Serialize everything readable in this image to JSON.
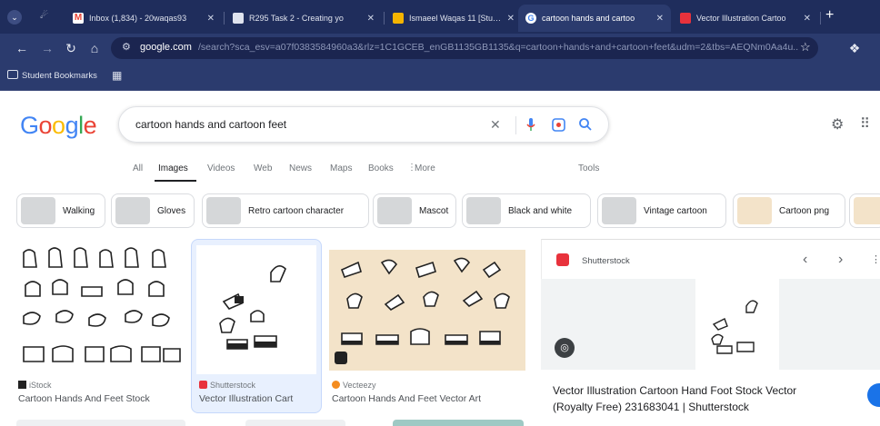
{
  "tabs": [
    {
      "label": "Inbox (1,834) - 20waqas93",
      "favicon": "gmail",
      "active": false
    },
    {
      "label": "R295 Task 2 - Creating yo",
      "favicon": "slides",
      "active": false
    },
    {
      "label": "Ismaeel Waqas 11 [Stude",
      "favicon": "slides-yellow",
      "active": false
    },
    {
      "label": "cartoon hands and cartoo",
      "favicon": "google",
      "active": true
    },
    {
      "label": "Vector Illustration Cartoo",
      "favicon": "shutterstock",
      "active": false
    }
  ],
  "toolbar": {
    "url_domain": "google.com",
    "url_rest": "/search?sca_esv=a07f0383584960a3&rlz=1C1GCEB_enGB1135GB1135&q=cartoon+hands+and+cartoon+feet&udm=2&tbs=AEQNm0Aa4u..."
  },
  "bookmarks": {
    "label": "Student Bookmarks"
  },
  "google": {
    "logo_letters": [
      "G",
      "o",
      "o",
      "g",
      "l",
      "e"
    ],
    "logo_colors": [
      "#4285f4",
      "#ea4335",
      "#fbbc05",
      "#4285f4",
      "#34a853",
      "#ea4335"
    ],
    "query": "cartoon hands and cartoon feet"
  },
  "nav": {
    "all": "All",
    "images": "Images",
    "videos": "Videos",
    "web": "Web",
    "news": "News",
    "maps": "Maps",
    "books": "Books",
    "more": "More",
    "tools": "Tools"
  },
  "chips": [
    "Walking",
    "Gloves",
    "Retro cartoon character",
    "Mascot",
    "Black and white",
    "Vintage cartoon",
    "Cartoon png"
  ],
  "results": [
    {
      "source": "iStock",
      "title": "Cartoon Hands And Feet Stock"
    },
    {
      "source": "Shutterstock",
      "title": "Vector Illustration Cart"
    },
    {
      "source": "Vecteezy",
      "title": "Cartoon Hands And Feet Vector Art"
    }
  ],
  "panel": {
    "source": "Shutterstock",
    "title_line1": "Vector Illustration Cartoon Hand Foot Stock Vector",
    "title_line2": "(Royalty Free) 231683041 | Shutterstock"
  }
}
